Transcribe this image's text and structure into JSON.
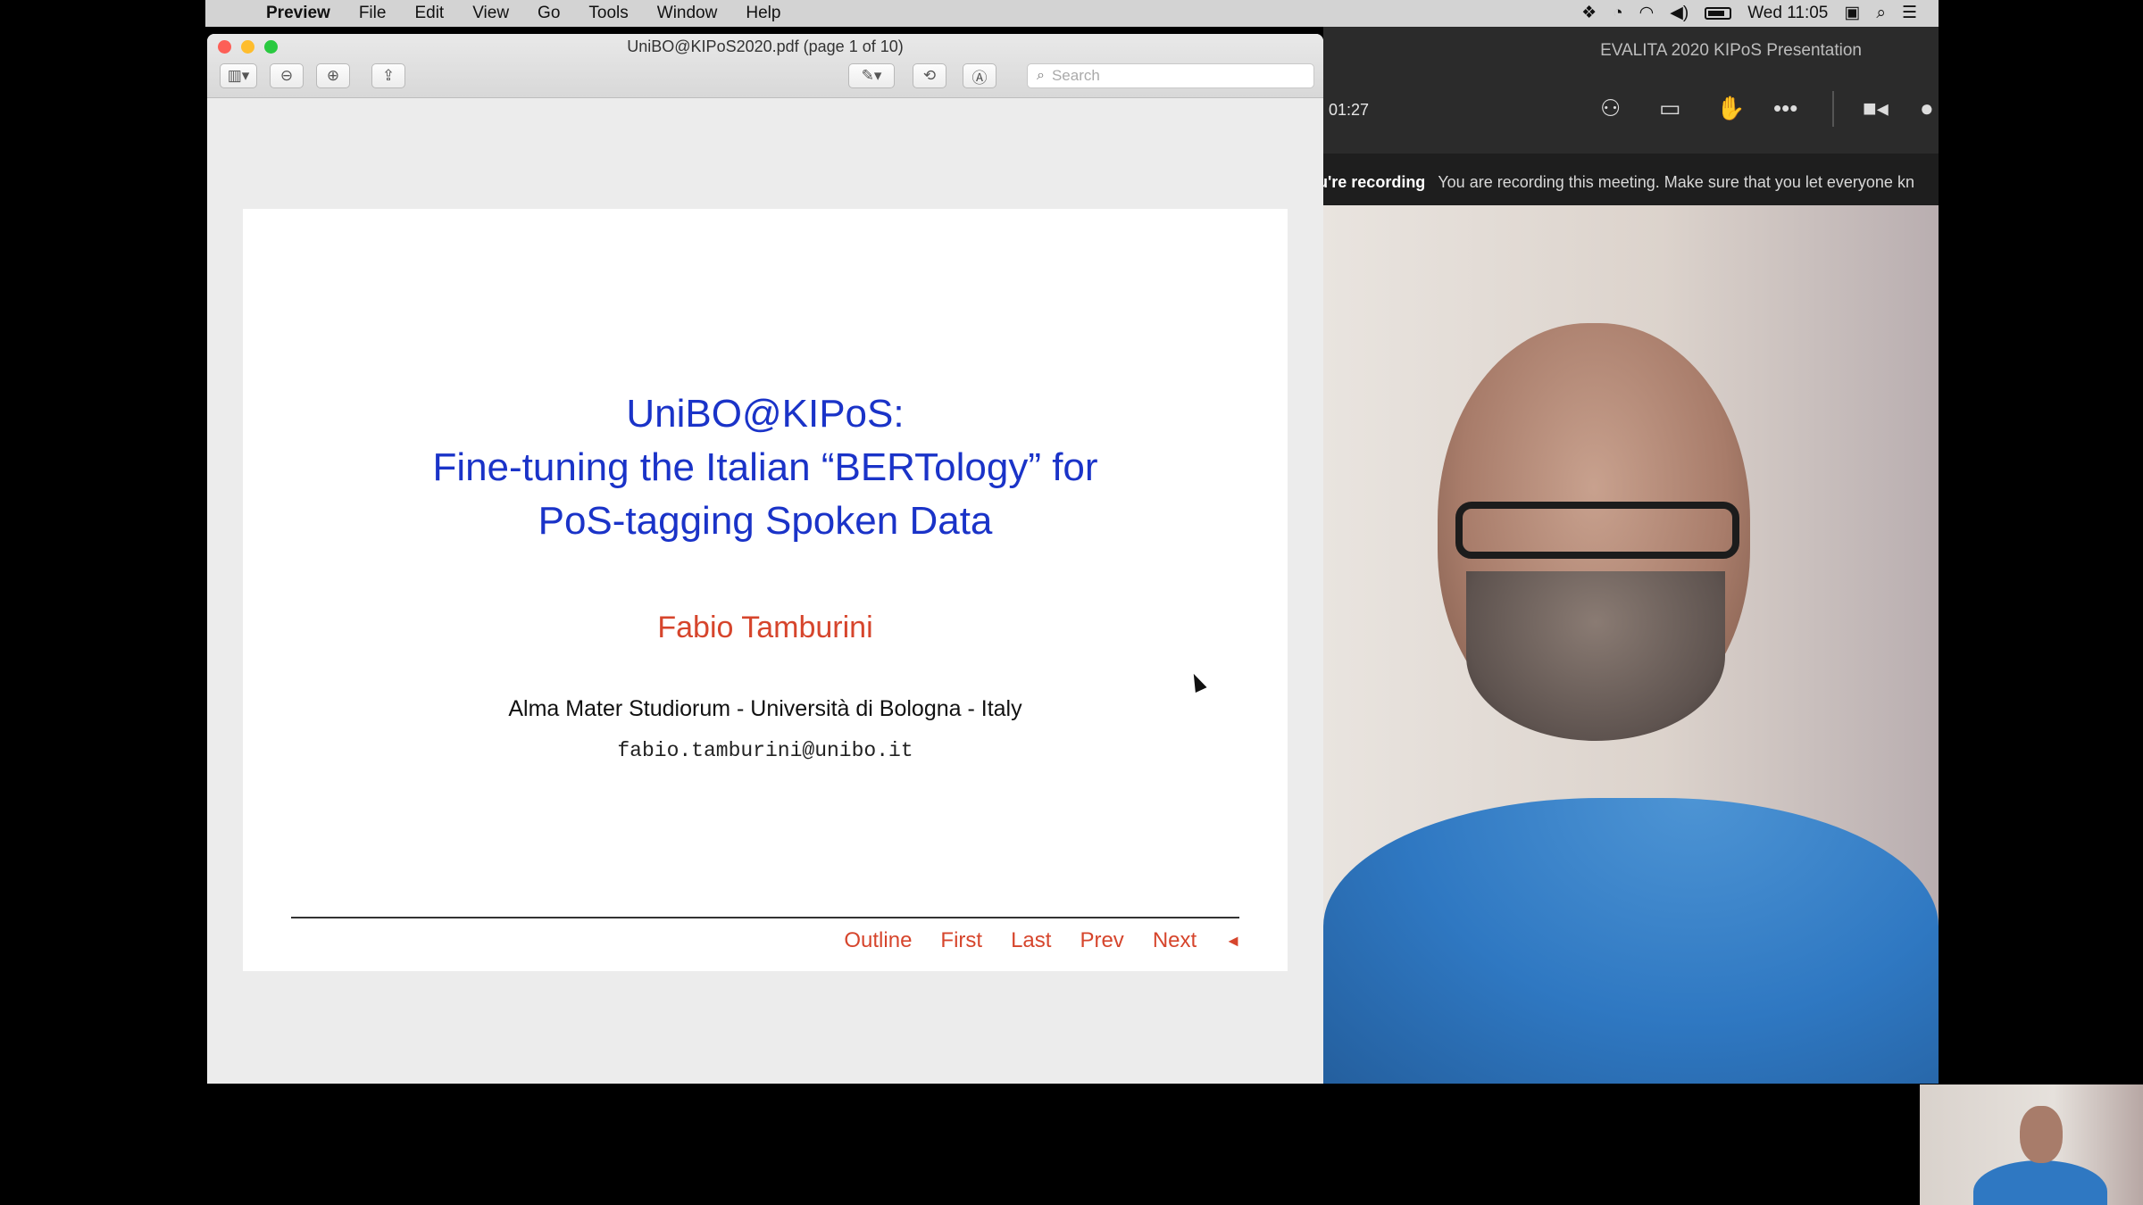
{
  "menubar": {
    "app_name": "Preview",
    "items": [
      "File",
      "Edit",
      "View",
      "Go",
      "Tools",
      "Window",
      "Help"
    ],
    "clock": "Wed 11:05"
  },
  "preview": {
    "window_title": "UniBO@KIPoS2020.pdf (page 1 of 10)",
    "search_placeholder": "Search"
  },
  "slide": {
    "title_lines": [
      "UniBO@KIPoS:",
      "Fine-tuning the Italian “BERTology” for",
      "PoS-tagging Spoken Data"
    ],
    "author": "Fabio Tamburini",
    "affiliation": "Alma Mater Studiorum - Università di Bologna - Italy",
    "email": "fabio.tamburini@unibo.it",
    "nav": {
      "outline": "Outline",
      "first": "First",
      "last": "Last",
      "prev": "Prev",
      "next": "Next",
      "back_symbol": "◄"
    }
  },
  "meeting": {
    "title": "EVALITA 2020 KIPoS Presentation",
    "timer": "01:27",
    "recording_label": "u're recording",
    "recording_message": "You are recording this meeting. Make sure that you let everyone kn"
  },
  "colors": {
    "slide_title": "#1a33c8",
    "slide_accent": "#d6452c",
    "menubar_bg": "#d3d3d3",
    "meeting_bg": "#2a2a2a"
  }
}
